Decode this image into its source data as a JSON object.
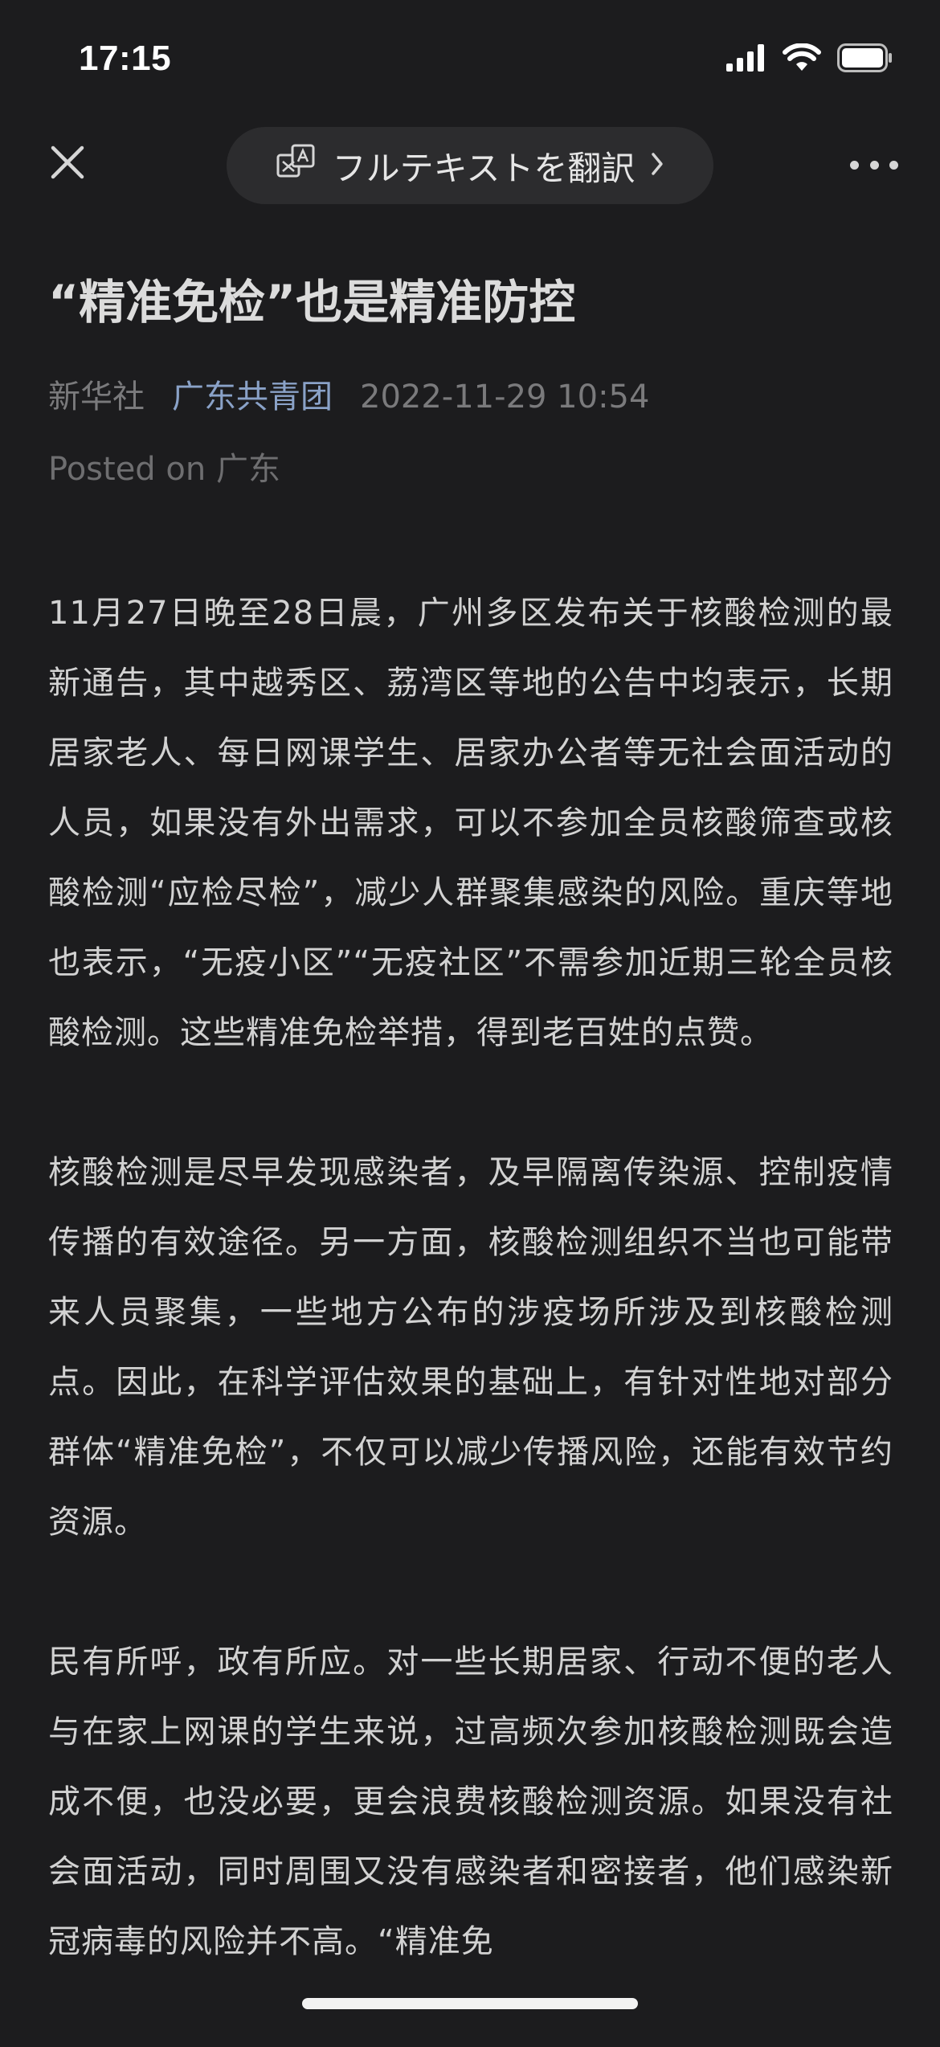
{
  "status_bar": {
    "time": "17:15"
  },
  "header": {
    "translate_label": "フルテキストを翻訳",
    "close_icon": "close-icon",
    "translate_icon": "translate-icon",
    "more_icon": "more-dots-icon"
  },
  "article": {
    "title": "“精准免检”也是精准防控",
    "source": "新华社",
    "account": "广东共青团",
    "date": "2022-11-29 10:54",
    "posted_on": "Posted on 广东",
    "paragraphs": [
      "11月27日晚至28日晨，广州多区发布关于核酸检测的最新通告，其中越秀区、荔湾区等地的公告中均表示，长期居家老人、每日网课学生、居家办公者等无社会面活动的人员，如果没有外出需求，可以不参加全员核酸筛查或核酸检测“应检尽检”，减少人群聚集感染的风险。重庆等地也表示，“无疫小区”“无疫社区”不需参加近期三轮全员核酸检测。这些精准免检举措，得到老百姓的点赞。",
      "核酸检测是尽早发现感染者，及早隔离传染源、控制疫情传播的有效途径。另一方面，核酸检测组织不当也可能带来人员聚集，一些地方公布的涉疫场所涉及到核酸检测点。因此，在科学评估效果的基础上，有针对性地对部分群体“精准免检”，不仅可以减少传播风险，还能有效节约资源。",
      "民有所呼，政有所应。对一些长期居家、行动不便的老人与在家上网课的学生来说，过高频次参加核酸检测既会造成不便，也没必要，更会浪费核酸检测资源。如果没有社会面活动，同时周围又没有感染者和密接者，他们感染新冠病毒的风险并不高。“精准免"
    ]
  },
  "colors": {
    "background": "#1c1c1e",
    "pill": "#2c2c2e",
    "account_link": "#8aa2c8",
    "meta_gray": "#7a7a7c"
  }
}
